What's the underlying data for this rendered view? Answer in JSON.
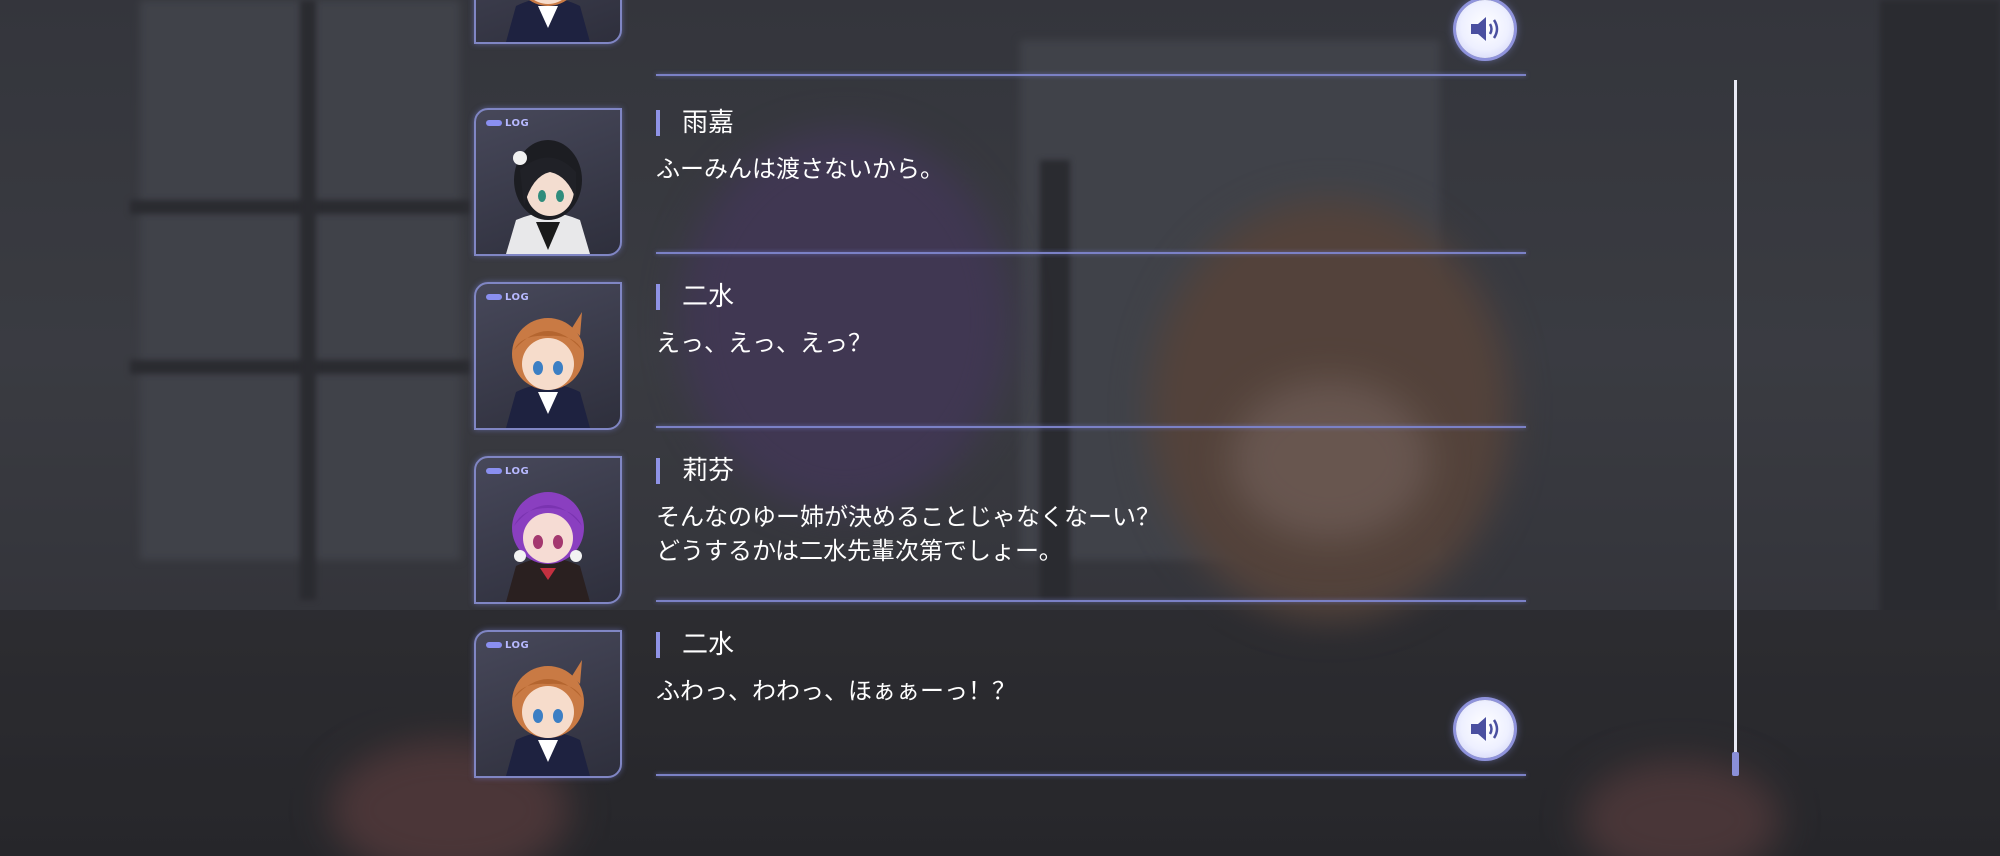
{
  "log_tag": "LOG",
  "entries": [
    {
      "speaker": "",
      "text": "",
      "voice": true,
      "character": "nisui"
    },
    {
      "speaker": "雨嘉",
      "text": "ふーみんは渡さないから。",
      "voice": false,
      "character": "uka"
    },
    {
      "speaker": "二水",
      "text": "えっ、えっ、えっ？",
      "voice": false,
      "character": "nisui"
    },
    {
      "speaker": "莉芬",
      "text": "そんなのゆー姉が決めることじゃなくなーい？\nどうするかは二水先輩次第でしょー。",
      "voice": false,
      "character": "rifen"
    },
    {
      "speaker": "二水",
      "text": "ふわっ、わわっ、ほぁぁーっ！？",
      "voice": true,
      "character": "nisui"
    }
  ],
  "colors": {
    "accent": "#8f93e6",
    "rule": "#7b81c6",
    "text": "#ffffff"
  },
  "icons": {
    "voice": "speaker-icon"
  }
}
